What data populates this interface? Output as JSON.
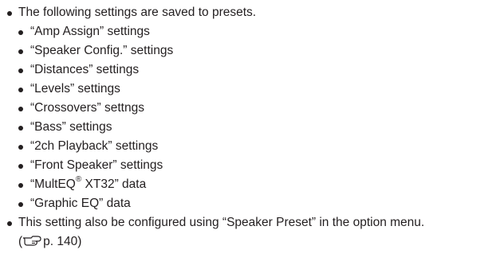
{
  "intro": "The following settings are saved to presets.",
  "items": [
    "“Amp Assign” settings",
    "“Speaker Config.” settings",
    "“Distances” settings",
    "“Levels” settings",
    "“Crossovers” settngs",
    "“Bass” settings",
    "“2ch Playback” settings",
    "“Front Speaker” settings",
    "“MultEQ",
    "“Graphic EQ” data"
  ],
  "multeq_sup": "®",
  "multeq_rest": " XT32” data",
  "note": "This setting also be configured using “Speaker Preset” in the option menu.",
  "ref_open": "(",
  "ref_icon": "reference-hand-icon",
  "ref_page": "p. 140)"
}
